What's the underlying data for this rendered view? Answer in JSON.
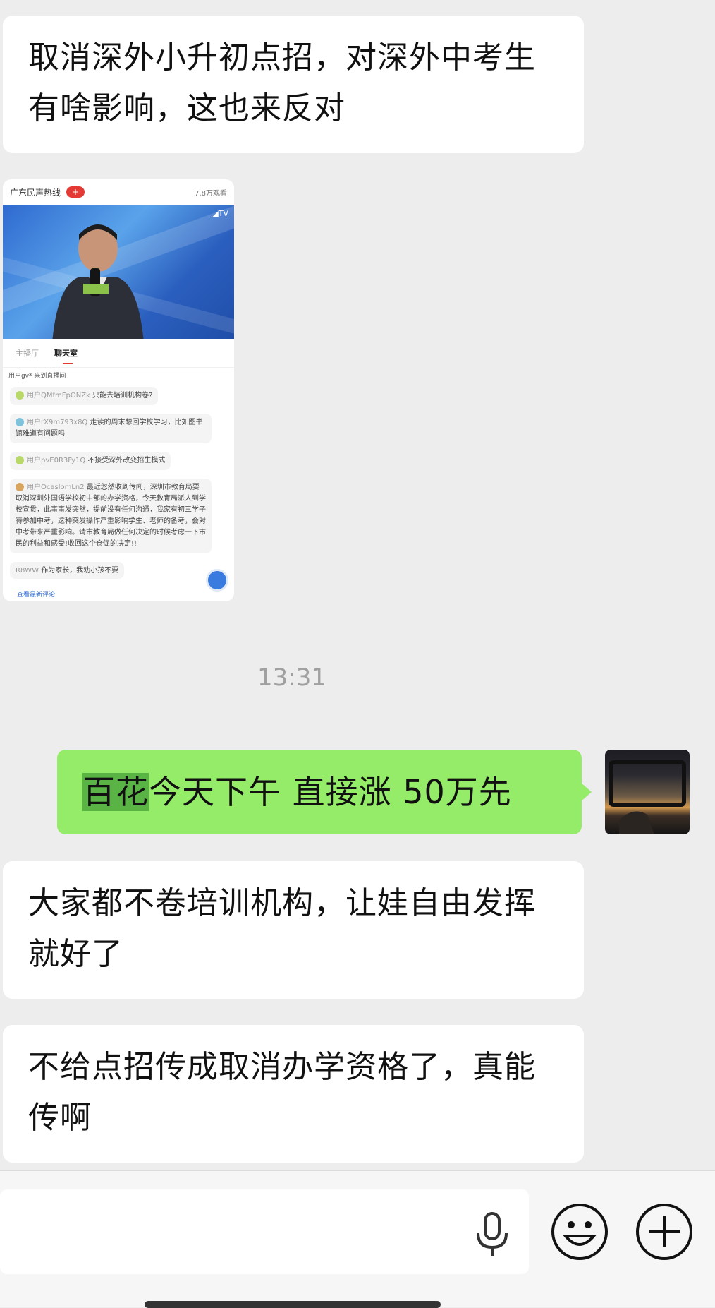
{
  "messages": {
    "m1": "取消深外小升初点招，对深外中考生有啥影响，这也来反对",
    "timestamp": "13:31",
    "out_highlight": "百花",
    "out_rest": "今天下午 直接涨 50万先",
    "m3": "大家都不卷培训机构，让娃自由发挥就好了",
    "m4": "不给点招传成取消办学资格了，真能传啊"
  },
  "image_card": {
    "channel": "广东民声热线",
    "views": "7.8万观看",
    "tab1": "主播厅",
    "tab2": "聊天室",
    "join": "用户gv* 来到直播间",
    "comments": [
      {
        "user": "用户QMfmFpONZk",
        "text": "只能去培训机构卷?"
      },
      {
        "user": "用户rX9m793x8Q",
        "text": "走读的周末想回学校学习，比如图书馆难道有问题吗"
      },
      {
        "user": "用户pvE0R3Fy1Q",
        "text": "不接受深外改变招生模式"
      },
      {
        "user": "用户OcaslomLn2",
        "text": "最近忽然收到传闻，深圳市教育局要取消深圳外国语学校初中部的办学资格，今天教育局派人到学校宣贯，此事事发突然，提前没有任何沟通，我家有初三学子待参加中考，这种突发操作严重影响学生、老师的备考，会对中考带来严重影响。请市教育局做任何决定的时候考虑一下市民的利益和感受!收回这个仓促的决定!!"
      },
      {
        "user": "R8WW",
        "text": "作为家长，我劝小孩不要"
      }
    ],
    "latest": "查看最新评论"
  },
  "icons": {
    "mic": "microphone-icon",
    "emoji": "emoji-icon",
    "plus": "plus-circle-icon"
  },
  "colors": {
    "background": "#ededed",
    "incoming_bubble": "#ffffff",
    "outgoing_bubble": "#95ec69",
    "highlight": "#59b445"
  }
}
